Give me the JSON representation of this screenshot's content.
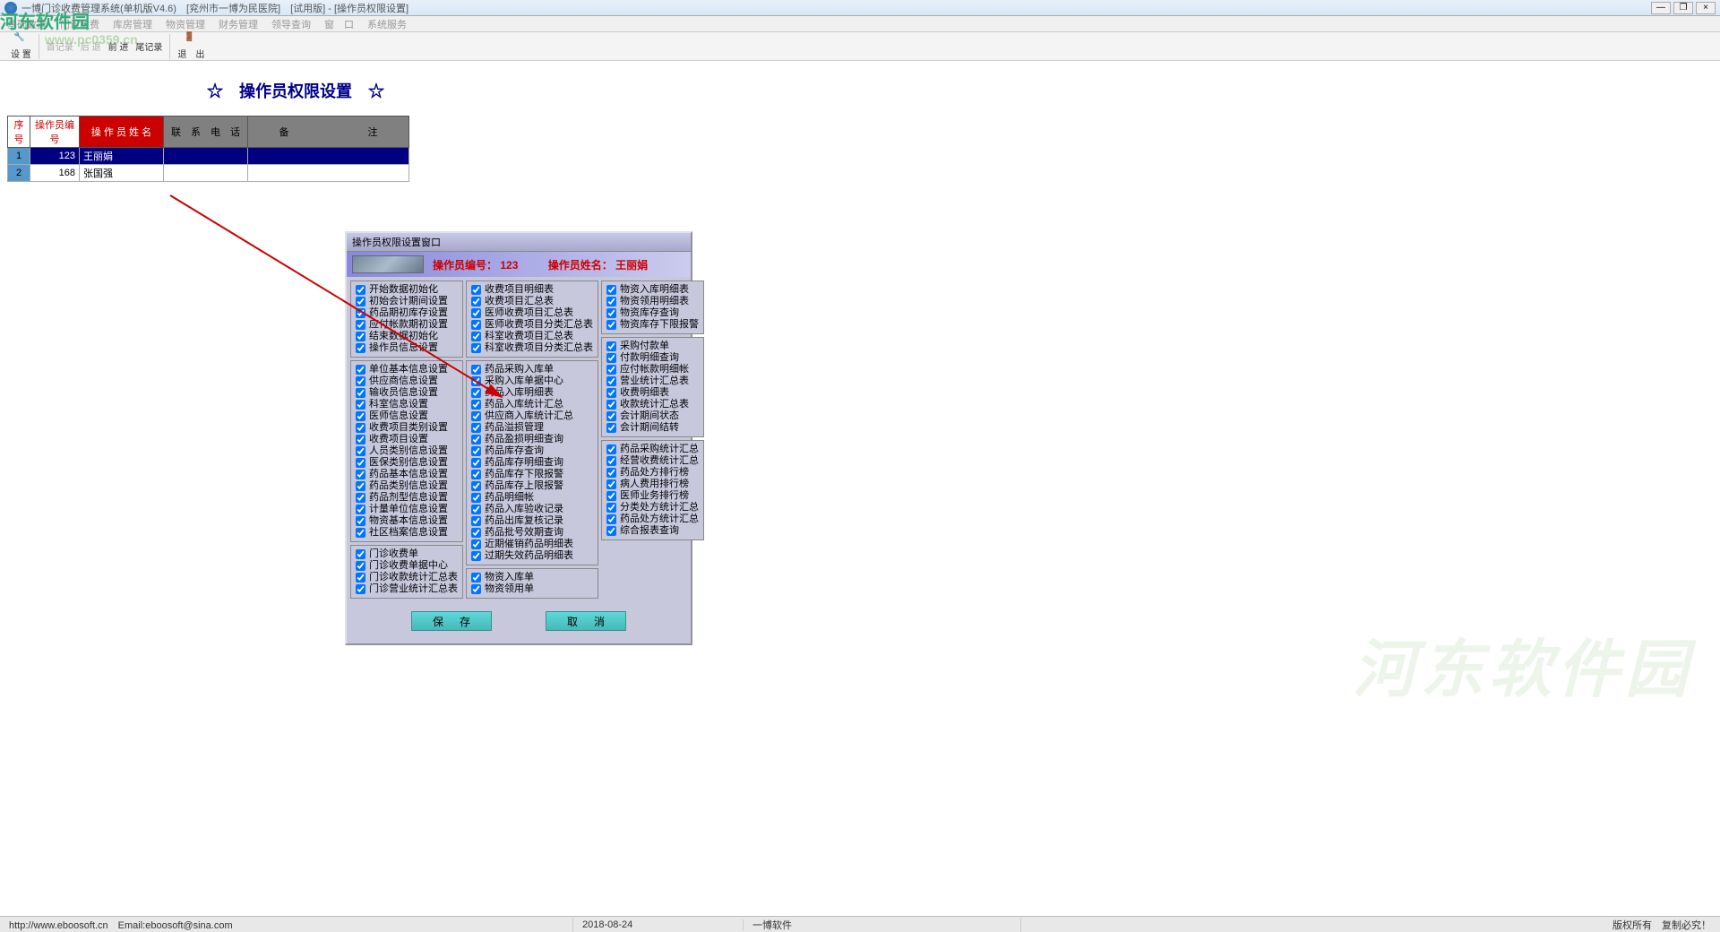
{
  "window": {
    "title": "一博门诊收费管理系统(单机版V4.6)　[兖州市一博为民医院]　[试用版] - [操作员权限设置]",
    "minimize": "—",
    "restore": "❐",
    "close": "×"
  },
  "menu": {
    "items": [
      "基础数据",
      "门诊收费",
      "库房管理",
      "物资管理",
      "财务管理",
      "领导查询",
      "窗　口",
      "系统服务"
    ]
  },
  "toolbar": {
    "setup": "设 置",
    "first": "首记录",
    "back": "后 退",
    "forward": "前 进",
    "last": "尾记录",
    "exit": "退　出",
    "watermark_url": "www.pc0359.cn",
    "logo_text": "河东软件园"
  },
  "page_title": "☆　操作员权限设置　☆",
  "table": {
    "headers": {
      "seq": "序号",
      "id": "操作员编号",
      "name": "操 作 员 姓 名",
      "phone": "联　系　电　话",
      "remark": "备　　　　　　　　注"
    },
    "rows": [
      {
        "seq": "1",
        "id": "123",
        "name": "王丽娟",
        "phone": "",
        "remark": "",
        "selected": true
      },
      {
        "seq": "2",
        "id": "168",
        "name": "张国强",
        "phone": "",
        "remark": "",
        "selected": false
      }
    ]
  },
  "dialog": {
    "title": "操作员权限设置窗口",
    "op_id_label": "操作员编号：",
    "op_id_value": "123",
    "op_name_label": "操作员姓名：",
    "op_name_value": "王丽娟",
    "save_label": "保存",
    "cancel_label": "取消",
    "col1": {
      "g1": [
        "开始数据初始化",
        "初始会计期间设置",
        "药品期初库存设置",
        "应付帐款期初设置",
        "结束数据初始化",
        "操作员信息设置"
      ],
      "g2": [
        "单位基本信息设置",
        "供应商信息设置",
        "输收员信息设置",
        "科室信息设置",
        "医师信息设置",
        "收费项目类别设置",
        "收费项目设置",
        "人员类别信息设置",
        "医保类别信息设置",
        "药品基本信息设置",
        "药品类别信息设置",
        "药品剂型信息设置",
        "计量单位信息设置",
        "物资基本信息设置",
        "社区档案信息设置"
      ],
      "g3": [
        "门诊收费单",
        "门诊收费单据中心",
        "门诊收款统计汇总表",
        "门诊营业统计汇总表"
      ]
    },
    "col2": {
      "g1": [
        "收费项目明细表",
        "收费项目汇总表",
        "医师收费项目汇总表",
        "医师收费项目分类汇总表",
        "科室收费项目汇总表",
        "科室收费项目分类汇总表"
      ],
      "g2": [
        "药品采购入库单",
        "采购入库单据中心",
        "药品入库明细表",
        "药品入库统计汇总",
        "供应商入库统计汇总",
        "药品溢损管理",
        "药品盈损明细查询",
        "药品库存查询",
        "药品库存明细查询",
        "药品库存下限报警",
        "药品库存上限报警",
        "药品明细帐",
        "药品入库验收记录",
        "药品出库复核记录",
        "药品批号效期查询",
        "近期催销药品明细表",
        "过期失效药品明细表"
      ],
      "g3": [
        "物资入库单",
        "物资领用单"
      ]
    },
    "col3": {
      "g1": [
        "物资入库明细表",
        "物资领用明细表",
        "物资库存查询",
        "物资库存下限报警"
      ],
      "g2": [
        "采购付款单",
        "付款明细查询",
        "应付帐款明细帐",
        "营业统计汇总表",
        "收费明细表",
        "收款统计汇总表",
        "会计期间状态",
        "会计期间结转"
      ],
      "g3": [
        "药品采购统计汇总",
        "经营收费统计汇总",
        "药品处方排行榜",
        "病人费用排行榜",
        "医师业务排行榜",
        "分类处方统计汇总",
        "药品处方统计汇总",
        "综合报表查询"
      ]
    }
  },
  "status": {
    "url_email": "http://www.eboosoft.cn　Email:eboosoft@sina.com",
    "date": "2018-08-24",
    "company": "一博软件",
    "copyright": "版权所有　复制必究！"
  },
  "big_watermark": "河东软件园"
}
